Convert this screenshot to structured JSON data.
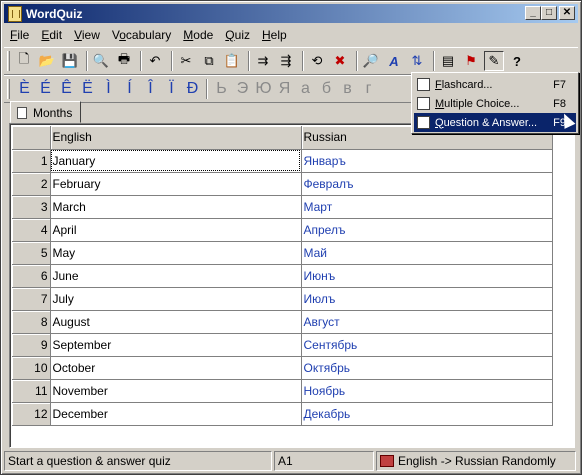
{
  "window": {
    "title": "WordQuiz",
    "min": "_",
    "max": "□",
    "close": "✕"
  },
  "menu": [
    {
      "pre": "",
      "u": "F",
      "post": "ile"
    },
    {
      "pre": "",
      "u": "E",
      "post": "dit"
    },
    {
      "pre": "",
      "u": "V",
      "post": "iew"
    },
    {
      "pre": "V",
      "u": "o",
      "post": "cabulary"
    },
    {
      "pre": "",
      "u": "M",
      "post": "ode"
    },
    {
      "pre": "",
      "u": "Q",
      "post": "uiz"
    },
    {
      "pre": "",
      "u": "H",
      "post": "elp"
    }
  ],
  "toolbar_icons": [
    "new-icon",
    "open-icon",
    "save-icon",
    "print-preview-icon",
    "print-icon",
    "undo-icon",
    "cut-icon",
    "copy-icon",
    "paste-icon",
    "insert-row-icon",
    "delete-row-icon",
    "revert-icon",
    "remove-icon",
    "find-icon",
    "font-icon",
    "sort-icon",
    "properties-icon",
    "flag-icon",
    "quiz-icon",
    "help-icon"
  ],
  "chars": [
    "È",
    "É",
    "Ê",
    "Ë",
    "Ì",
    "Í",
    "Î",
    "Ï",
    "Đ",
    "Ь",
    "Э",
    "Ю",
    "Я",
    "а",
    "б",
    "в",
    "г"
  ],
  "tab": {
    "label": "Months"
  },
  "table": {
    "headers": [
      "English",
      "Russian"
    ],
    "rows": [
      {
        "n": "1",
        "en": "January",
        "ru": "Январъ"
      },
      {
        "n": "2",
        "en": "February",
        "ru": "Февралъ"
      },
      {
        "n": "3",
        "en": "March",
        "ru": "Март"
      },
      {
        "n": "4",
        "en": "April",
        "ru": "Апрелъ"
      },
      {
        "n": "5",
        "en": "May",
        "ru": "Май"
      },
      {
        "n": "6",
        "en": "June",
        "ru": "Июнъ"
      },
      {
        "n": "7",
        "en": "July",
        "ru": "Июлъ"
      },
      {
        "n": "8",
        "en": "August",
        "ru": "Август"
      },
      {
        "n": "9",
        "en": "September",
        "ru": "Сентябрь"
      },
      {
        "n": "10",
        "en": "October",
        "ru": "Октябрь"
      },
      {
        "n": "11",
        "en": "November",
        "ru": "Ноябрь"
      },
      {
        "n": "12",
        "en": "December",
        "ru": "Декабрь"
      }
    ]
  },
  "popup": [
    {
      "u": "F",
      "post": "lashcard...",
      "key": "F7",
      "icon": "flashcard-icon"
    },
    {
      "u": "M",
      "post": "ultiple Choice...",
      "key": "F8",
      "icon": "multiple-choice-icon"
    },
    {
      "u": "Q",
      "post": "uestion & Answer...",
      "key": "F9",
      "icon": "question-answer-icon"
    }
  ],
  "status": {
    "hint": "Start a question & answer quiz",
    "cell": "A1",
    "direction": "English -> Russian Randomly"
  }
}
